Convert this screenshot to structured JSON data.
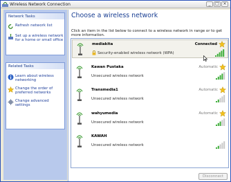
{
  "window": {
    "title": "Wireless Network Connection"
  },
  "sidebar": {
    "network_tasks": {
      "header": "Network Tasks",
      "items": [
        {
          "icon": "refresh-icon",
          "label_lines": [
            "Refresh network list"
          ]
        },
        {
          "icon": "setup-icon",
          "label_lines": [
            "Set up a wireless network",
            "for a home or small office"
          ]
        }
      ]
    },
    "related_tasks": {
      "header": "Related Tasks",
      "items": [
        {
          "icon": "info-icon",
          "label_lines": [
            "Learn about wireless",
            "networking"
          ]
        },
        {
          "icon": "star-icon",
          "label_lines": [
            "Change the order of",
            "preferred networks"
          ]
        },
        {
          "icon": "gear-icon",
          "label_lines": [
            "Change advanced",
            "settings"
          ]
        }
      ]
    }
  },
  "main": {
    "heading": "Choose a wireless network",
    "intro": "Click an item in the list below to connect to a wireless network in range or to get more information.",
    "networks": [
      {
        "name": "mediakita",
        "status": "Connected",
        "description": "Security-enabled wireless network (WPA)",
        "secured": true,
        "selected": true,
        "signal_bars": 5
      },
      {
        "name": "Kawan Pustaka",
        "status": "Automatic",
        "description": "Unsecured wireless network",
        "secured": false,
        "selected": false,
        "signal_bars": 4
      },
      {
        "name": "Transmedia1",
        "status": "Automatic",
        "description": "Unsecured wireless network",
        "secured": false,
        "selected": false,
        "signal_bars": 2
      },
      {
        "name": "wahyumedia",
        "status": "Automatic",
        "description": "Unsecured wireless network",
        "secured": false,
        "selected": false,
        "signal_bars": 3
      },
      {
        "name": "KAWAH",
        "status": "",
        "description": "Unsecured wireless network",
        "secured": false,
        "selected": false,
        "signal_bars": 2
      }
    ],
    "disconnect_label": "Disconnect"
  },
  "colors": {
    "accent": "#1a3f93",
    "sidebar_bg": "#b8c9ec",
    "signal": "#3fae3a",
    "signal_off": "#c9c9c9",
    "star": "#f2c01d"
  }
}
